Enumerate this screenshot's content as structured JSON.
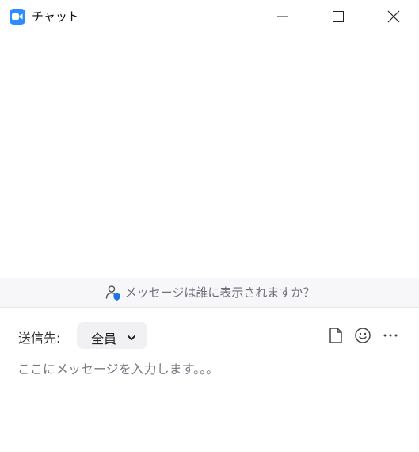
{
  "window": {
    "title": "チャット",
    "accent_color": "#2D8CFF"
  },
  "banner": {
    "text": "メッセージは誰に表示されますか？",
    "icon": "user-shield-icon"
  },
  "compose": {
    "recipient_label": "送信先:",
    "recipient_value": "全員",
    "message_placeholder": "ここにメッセージを入力します。。。",
    "toolbar_icons": [
      "file-icon",
      "emoji-icon",
      "more-icon"
    ]
  }
}
